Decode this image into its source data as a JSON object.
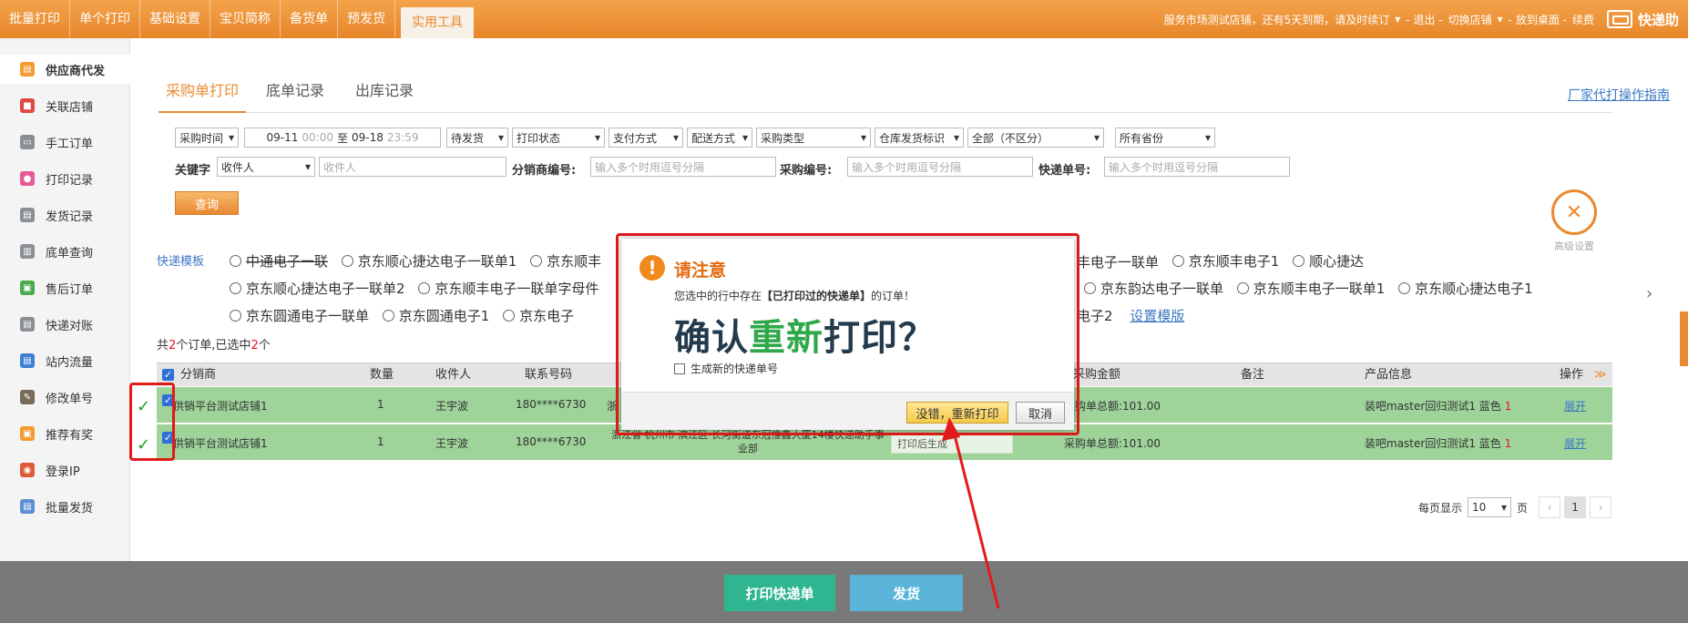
{
  "topnav": {
    "items": [
      "批量打印",
      "单个打印",
      "基础设置",
      "宝贝简称",
      "备货单",
      "预发货"
    ],
    "active": "实用工具"
  },
  "topright": {
    "notice": "服务市场测试店铺，还有5天到期，请及时续订",
    "logout": "- 退出 -",
    "switch_shop": "切换店铺",
    "desktop": "- 放到桌面 -",
    "renew": "续费",
    "brand": "快递助"
  },
  "sidebar": {
    "items": [
      {
        "label": "供应商代发",
        "color": "#f39b2e"
      },
      {
        "label": "关联店铺",
        "color": "#e0473e"
      },
      {
        "label": "手工订单",
        "color": "#8a8f96"
      },
      {
        "label": "打印记录",
        "color": "#e75a9a"
      },
      {
        "label": "发货记录",
        "color": "#8a8f96"
      },
      {
        "label": "底单查询",
        "color": "#8a8f96"
      },
      {
        "label": "售后订单",
        "color": "#4aa84a"
      },
      {
        "label": "快递对账",
        "color": "#8a8f96"
      },
      {
        "label": "站内流量",
        "color": "#3c7fd4"
      },
      {
        "label": "修改单号",
        "color": "#7a6a5a"
      },
      {
        "label": "推荐有奖",
        "color": "#f39b2e"
      },
      {
        "label": "登录IP",
        "color": "#e05a3a"
      },
      {
        "label": "批量发货",
        "color": "#5a8fd4"
      }
    ]
  },
  "tabs": [
    "采购单打印",
    "底单记录",
    "出库记录"
  ],
  "guide_link": "厂家代打操作指南",
  "filters": {
    "time_type": "采购时间",
    "date_start": "09-11",
    "time_start": "00:00",
    "date_sep": "至",
    "date_end": "09-18",
    "time_end": "23:59",
    "ship_status": "待发货",
    "print_status": "打印状态",
    "pay_method": "支付方式",
    "delivery": "配送方式",
    "purchase_type": "采购类型",
    "warehouse": "仓库发货标识",
    "all_flag": "全部（不区分）",
    "province": "所有省份",
    "keyword_label": "关键字",
    "keyword_field": "收件人",
    "keyword_placeholder": "收件人",
    "distributor_label": "分销商编号:",
    "distributor_placeholder": "输入多个时用逗号分隔",
    "purchase_no_label": "采购编号:",
    "purchase_no_placeholder": "输入多个时用逗号分隔",
    "express_no_label": "快递单号:",
    "express_no_placeholder": "输入多个时用逗号分隔",
    "query": "查询"
  },
  "advanced": "高级设置",
  "template": {
    "label": "快递模板",
    "row1": [
      "中通电子一联",
      "京东顺心捷达电子一联单1",
      "京东顺丰",
      "丰电子一联单",
      "京东顺丰电子1",
      "顺心捷达"
    ],
    "row2": [
      "京东顺心捷达电子一联单2",
      "京东顺丰电子一联单字母件",
      "京东韵达电子一联单",
      "京东顺丰电子一联单1",
      "京东顺心捷达电子1"
    ],
    "row3": [
      "京东圆通电子一联单",
      "京东圆通电子1",
      "京东电子",
      "电子2"
    ],
    "setup": "设置模版"
  },
  "counts": {
    "prefix": "共",
    "total": "2",
    "mid": "个订单,已选中",
    "selected": "2",
    "suffix": "个"
  },
  "table": {
    "headers": [
      "分销商",
      "数量",
      "收件人",
      "联系号码",
      "采购金额",
      "备注",
      "产品信息",
      "操作"
    ],
    "rows": [
      {
        "distributor": "供销平台测试店铺1",
        "qty": "1",
        "recipient": "王宇波",
        "phone": "180****6730",
        "address": "浙",
        "print_note": "",
        "amount": "采购单总额:101.00",
        "product": "装吧master回归测试1 蓝色",
        "product_qty": "1",
        "action": "展开"
      },
      {
        "distributor": "供销平台测试店铺1",
        "qty": "1",
        "recipient": "王宇波",
        "phone": "180****6730",
        "address": "浙江省 杭州市 滨江区 长河街道东冠惟鑫大厦14楼快递助手事业部",
        "print_note": "打印后生成",
        "amount": "采购单总额:101.00",
        "product": "装吧master回归测试1 蓝色",
        "product_qty": "1",
        "action": "展开"
      }
    ]
  },
  "pager": {
    "per_page_label": "每页显示",
    "per_page": "10",
    "unit": "页",
    "prev": "‹",
    "current": "1",
    "next": "›"
  },
  "bottom": {
    "print_express": "打印快递单",
    "ship": "发货"
  },
  "dialog": {
    "title": "请注意",
    "msg_prefix": "您选中的行中存在",
    "msg_em": "【已打印过的快递单】",
    "msg_suffix": "的订单！",
    "big_a": "确认",
    "big_b": "重新",
    "big_c": "打印？",
    "checkbox": "生成新的快递单号",
    "confirm": "没错，重新打印",
    "cancel": "取消"
  }
}
